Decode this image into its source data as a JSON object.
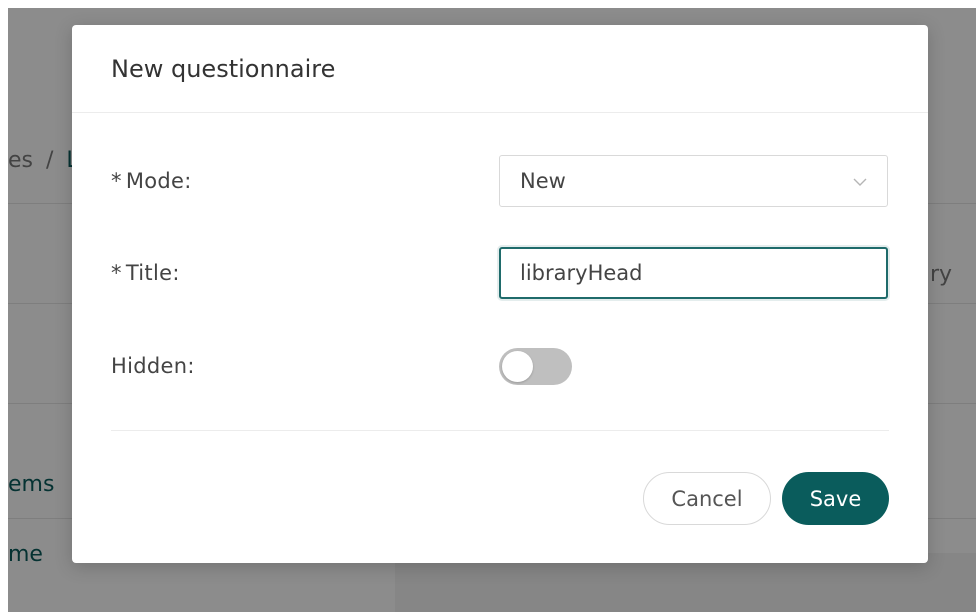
{
  "background": {
    "breadcrumb_fragment": "es",
    "breadcrumb_separator": "/",
    "breadcrumb_next": "L",
    "right_fragment": "ry",
    "items_fragment": "ems",
    "home_fragment": "me"
  },
  "dialog": {
    "title": "New questionnaire",
    "mode": {
      "required_mark": "*",
      "label": "Mode",
      "colon": ":",
      "value": "New",
      "icon": "chevron-down-icon"
    },
    "title_field": {
      "required_mark": "*",
      "label": "Title",
      "colon": ":",
      "value": "libraryHead"
    },
    "hidden": {
      "label": "Hidden",
      "colon": ":",
      "on": false
    },
    "buttons": {
      "cancel": "Cancel",
      "save": "Save"
    }
  },
  "colors": {
    "accent": "#0a5c5c",
    "focus_border": "#1f6b6b",
    "toggle_off": "#bfbfbf"
  }
}
